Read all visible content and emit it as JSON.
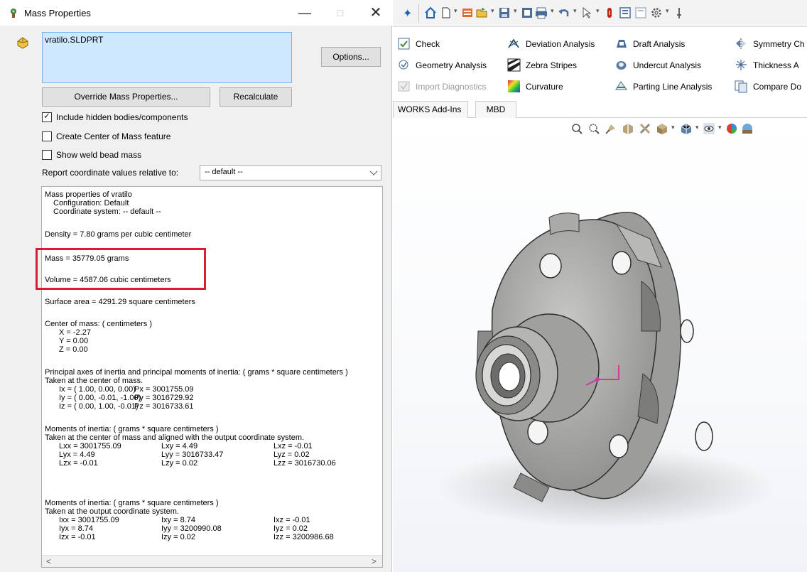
{
  "dialog": {
    "title": "Mass Properties",
    "window_buttons": {
      "minimize": "—",
      "maximize": "□",
      "close": "✕"
    },
    "selected_file": "vratilo.SLDPRT",
    "options_label": "Options...",
    "override_label": "Override Mass Properties...",
    "recalculate_label": "Recalculate",
    "checkboxes": [
      {
        "label": "Include hidden bodies/components",
        "checked": true
      },
      {
        "label": "Create Center of Mass feature",
        "checked": false
      },
      {
        "label": "Show weld bead mass",
        "checked": false
      }
    ],
    "coord_label": "Report coordinate values relative to:",
    "coord_value": "-- default --",
    "results": {
      "header": "Mass properties of vratilo",
      "configuration": "Configuration: Default",
      "coordinate_system": "Coordinate system: -- default --",
      "density": "Density = 7.80 grams per cubic centimeter",
      "mass": "Mass = 35779.05 grams",
      "volume": "Volume = 4587.06 cubic centimeters",
      "surface_area": "Surface area = 4291.29  square centimeters",
      "com_title": "Center of mass: ( centimeters )",
      "com_x": "X = -2.27",
      "com_y": "Y = 0.00",
      "com_z": "Z = 0.00",
      "principal_title": "Principal axes of inertia and principal moments of inertia: ( grams *  square centimeters )",
      "principal_taken": "Taken at the center of mass.",
      "principal_rows": [
        {
          "axis": "Ix = ( 1.00,  0.00,  0.00)",
          "moment": "Px = 3001755.09"
        },
        {
          "axis": "Iy = ( 0.00, -0.01, -1.00)",
          "moment": "Py = 3016729.92"
        },
        {
          "axis": "Iz = ( 0.00,  1.00, -0.01)",
          "moment": "Pz = 3016733.61"
        }
      ],
      "moi_com_title": "Moments of inertia: ( grams *  square centimeters )",
      "moi_com_taken": "Taken at the center of mass and aligned with the output coordinate system.",
      "moi_com_rows": [
        [
          "Lxx = 3001755.09",
          "Lxy = 4.49",
          "Lxz = -0.01"
        ],
        [
          "Lyx = 4.49",
          "Lyy = 3016733.47",
          "Lyz = 0.02"
        ],
        [
          "Lzx = -0.01",
          "Lzy = 0.02",
          "Lzz = 3016730.06"
        ]
      ],
      "moi_out_title": "Moments of inertia: ( grams *  square centimeters )",
      "moi_out_taken": "Taken at the output coordinate system.",
      "moi_out_rows": [
        [
          "Ixx = 3001755.09",
          "Ixy = 8.74",
          "Ixz = -0.01"
        ],
        [
          "Iyx = 8.74",
          "Iyy = 3200990.08",
          "Iyz = 0.02"
        ],
        [
          "Izx = -0.01",
          "Izy = 0.02",
          "Izz = 3200986.68"
        ]
      ]
    }
  },
  "scroll_arrows": {
    "left": "<",
    "right": ">"
  },
  "ribbon": {
    "col1": [
      "Check",
      "Geometry Analysis",
      "Import Diagnostics"
    ],
    "col2": [
      "Deviation Analysis",
      "Zebra Stripes",
      "Curvature"
    ],
    "col3": [
      "Draft Analysis",
      "Undercut Analysis",
      "Parting Line Analysis"
    ],
    "col4": [
      "Symmetry Ch",
      "Thickness A",
      "Compare Do"
    ]
  },
  "tabs": [
    "WORKS Add-Ins",
    "MBD"
  ],
  "colors": {
    "accent": "#1b62b5",
    "highlight": "#d81e2a",
    "selection": "#cde8ff",
    "model": "#a9a9a7"
  }
}
